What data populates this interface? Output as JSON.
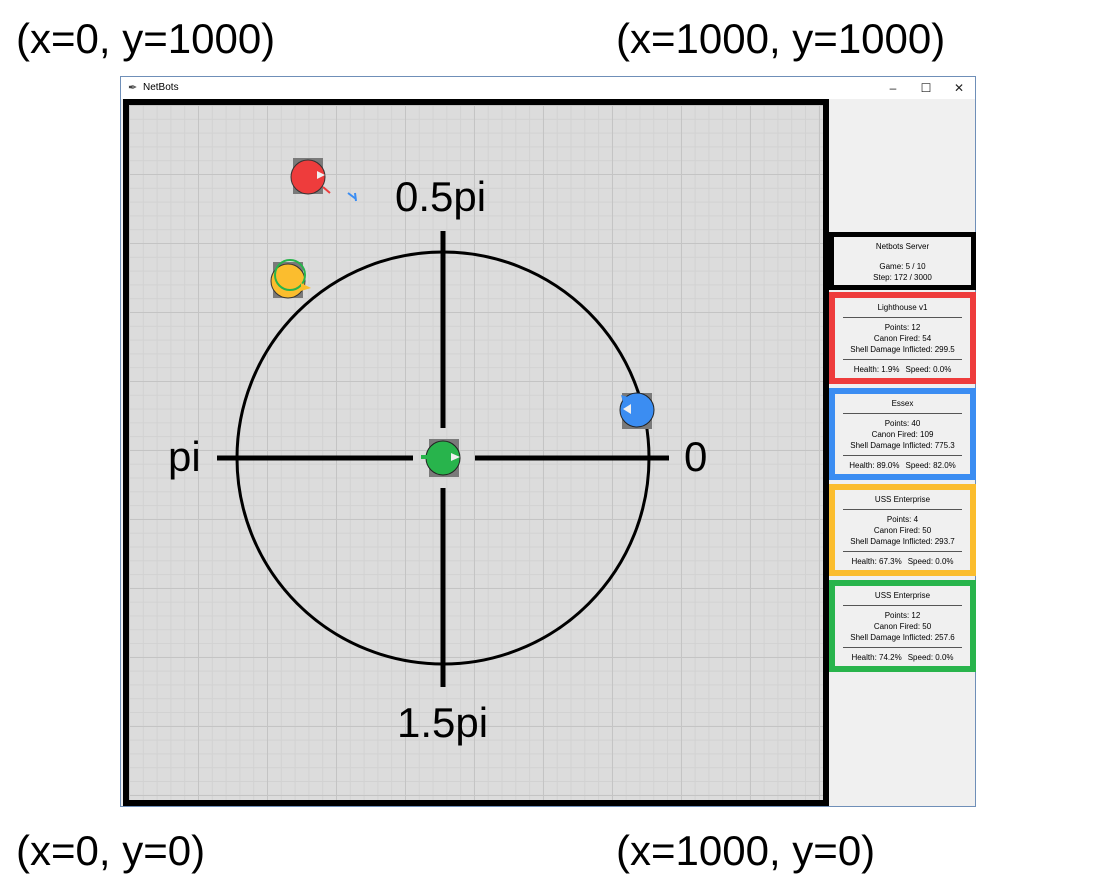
{
  "corner_labels": {
    "top_left": "(x=0, y=1000)",
    "top_right": "(x=1000, y=1000)",
    "bottom_left": "(x=0, y=0)",
    "bottom_right": "(x=1000, y=0)"
  },
  "window": {
    "title": "NetBots",
    "icon": "feather-icon",
    "controls": {
      "minimize": "–",
      "maximize": "☐",
      "close": "✕"
    }
  },
  "arena_labels": {
    "angle_half_pi": "0.5pi",
    "angle_pi": "pi",
    "angle_zero": "0",
    "angle_one_half_pi": "1.5pi"
  },
  "server": {
    "name": "Netbots Server",
    "game": "Game: 5 / 10",
    "step": "Step: 172 / 3000"
  },
  "bots": [
    {
      "name": "Lighthouse v1",
      "color": "#ee3c3c",
      "points": "Points: 12",
      "canon": "Canon Fired: 54",
      "damage": "Shell Damage Inflicted: 299.5",
      "health": "Health: 1.9%",
      "speed": "Speed: 0.0%"
    },
    {
      "name": "Essex",
      "color": "#3b8df2",
      "points": "Points: 40",
      "canon": "Canon Fired: 109",
      "damage": "Shell Damage Inflicted: 775.3",
      "health": "Health: 89.0%",
      "speed": "Speed: 82.0%"
    },
    {
      "name": "USS Enterprise",
      "color": "#fbbd2e",
      "points": "Points: 4",
      "canon": "Canon Fired: 50",
      "damage": "Shell Damage Inflicted: 293.7",
      "health": "Health: 67.3%",
      "speed": "Speed: 0.0%"
    },
    {
      "name": "USS Enterprise",
      "color": "#28b44c",
      "points": "Points: 12",
      "canon": "Canon Fired: 50",
      "damage": "Shell Damage Inflicted: 257.6",
      "health": "Health: 74.2%",
      "speed": "Speed: 0.0%"
    }
  ]
}
